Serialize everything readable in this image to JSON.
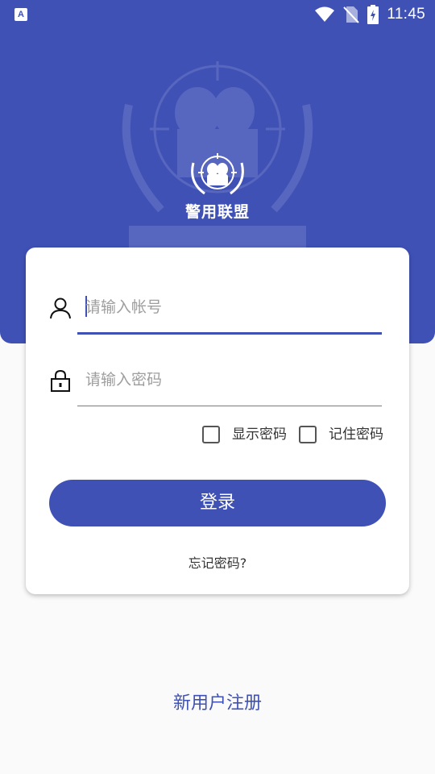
{
  "colors": {
    "primary": "#3f51b5",
    "background": "#fafafa",
    "card": "#ffffff"
  },
  "status_bar": {
    "app_icon": "A",
    "time": "11:45",
    "icons": [
      "wifi-icon",
      "no-sim-icon",
      "battery-icon"
    ]
  },
  "header": {
    "logo_icon": "police-alliance-logo-icon",
    "logo_text": "警用联盟"
  },
  "login_form": {
    "account": {
      "icon": "user-icon",
      "placeholder": "请输入帐号",
      "value": ""
    },
    "password": {
      "icon": "lock-icon",
      "placeholder": "请输入密码",
      "value": ""
    },
    "show_password": {
      "label": "显示密码",
      "checked": false
    },
    "remember_password": {
      "label": "记住密码",
      "checked": false
    },
    "login_button": "登录",
    "forgot_password": "忘记密码?"
  },
  "register_link": "新用户注册"
}
